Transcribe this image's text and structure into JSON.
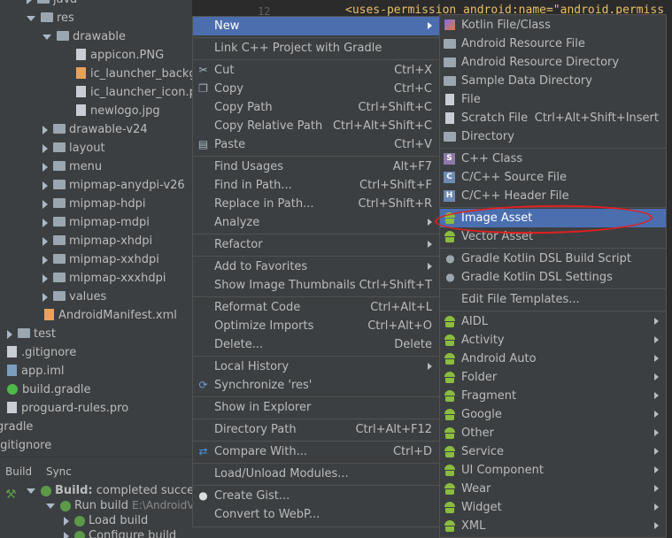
{
  "tree": {
    "items": [
      {
        "label": "java",
        "indent": 1,
        "kind": "folder",
        "arrow": "right"
      },
      {
        "label": "res",
        "indent": 1,
        "kind": "folder",
        "arrow": "down"
      },
      {
        "label": "drawable",
        "indent": 2,
        "kind": "folder",
        "arrow": "down"
      },
      {
        "label": "appicon.PNG",
        "indent": 3,
        "kind": "file"
      },
      {
        "label": "ic_launcher_backgr",
        "indent": 3,
        "kind": "xml"
      },
      {
        "label": "ic_launcher_icon.pn",
        "indent": 3,
        "kind": "file"
      },
      {
        "label": "newlogo.jpg",
        "indent": 3,
        "kind": "file"
      },
      {
        "label": "drawable-v24",
        "indent": 2,
        "kind": "folder",
        "arrow": "right"
      },
      {
        "label": "layout",
        "indent": 2,
        "kind": "folder",
        "arrow": "right"
      },
      {
        "label": "menu",
        "indent": 2,
        "kind": "folder",
        "arrow": "right"
      },
      {
        "label": "mipmap-anydpi-v26",
        "indent": 2,
        "kind": "folder",
        "arrow": "right"
      },
      {
        "label": "mipmap-hdpi",
        "indent": 2,
        "kind": "folder",
        "arrow": "right"
      },
      {
        "label": "mipmap-mdpi",
        "indent": 2,
        "kind": "folder",
        "arrow": "right"
      },
      {
        "label": "mipmap-xhdpi",
        "indent": 2,
        "kind": "folder",
        "arrow": "right"
      },
      {
        "label": "mipmap-xxhdpi",
        "indent": 2,
        "kind": "folder",
        "arrow": "right"
      },
      {
        "label": "mipmap-xxxhdpi",
        "indent": 2,
        "kind": "folder",
        "arrow": "right"
      },
      {
        "label": "values",
        "indent": 2,
        "kind": "folder",
        "arrow": "right"
      },
      {
        "label": "AndroidManifest.xml",
        "indent": 2,
        "kind": "xml"
      },
      {
        "label": "test",
        "indent": 0,
        "kind": "folder",
        "arrow": "right"
      },
      {
        "label": ".gitignore",
        "indent": 0,
        "kind": "file"
      },
      {
        "label": "app.iml",
        "indent": 0,
        "kind": "iml"
      },
      {
        "label": "build.gradle",
        "indent": 0,
        "kind": "gradle"
      },
      {
        "label": "proguard-rules.pro",
        "indent": 0,
        "kind": "file"
      },
      {
        "label": "gradle",
        "indent": -1,
        "kind": "none"
      },
      {
        "label": ".gitignore",
        "indent": -1,
        "kind": "none"
      }
    ]
  },
  "editor": {
    "line_number": "12",
    "code": "<uses-permission android:name=\"android.permiss"
  },
  "build": {
    "tabs": [
      "Build",
      "Sync"
    ],
    "status_bold": "Build:",
    "status_text": "completed success",
    "run_build": "Run build",
    "run_path": "E:\\AndroidV",
    "load_build": "Load build",
    "configure_build": "Configure build"
  },
  "menu1": {
    "items": [
      {
        "label": "New",
        "shortcut": "",
        "arrow": true,
        "icon": "",
        "selected": true
      },
      {
        "sep": true
      },
      {
        "label": "Link C++ Project with Gradle",
        "shortcut": "",
        "arrow": false,
        "icon": ""
      },
      {
        "sep": true
      },
      {
        "label": "Cut",
        "shortcut": "Ctrl+X",
        "arrow": false,
        "icon": "scissors-icon"
      },
      {
        "label": "Copy",
        "shortcut": "Ctrl+C",
        "arrow": false,
        "icon": "copy-icon"
      },
      {
        "label": "Copy Path",
        "shortcut": "Ctrl+Shift+C",
        "arrow": false,
        "icon": ""
      },
      {
        "label": "Copy Relative Path",
        "shortcut": "Ctrl+Alt+Shift+C",
        "arrow": false,
        "icon": ""
      },
      {
        "label": "Paste",
        "shortcut": "Ctrl+V",
        "arrow": false,
        "icon": "paste-icon"
      },
      {
        "sep": true
      },
      {
        "label": "Find Usages",
        "shortcut": "Alt+F7",
        "arrow": false,
        "icon": ""
      },
      {
        "label": "Find in Path...",
        "shortcut": "Ctrl+Shift+F",
        "arrow": false,
        "icon": ""
      },
      {
        "label": "Replace in Path...",
        "shortcut": "Ctrl+Shift+R",
        "arrow": false,
        "icon": ""
      },
      {
        "label": "Analyze",
        "shortcut": "",
        "arrow": true,
        "icon": ""
      },
      {
        "sep": true
      },
      {
        "label": "Refactor",
        "shortcut": "",
        "arrow": true,
        "icon": ""
      },
      {
        "sep": true
      },
      {
        "label": "Add to Favorites",
        "shortcut": "",
        "arrow": true,
        "icon": ""
      },
      {
        "label": "Show Image Thumbnails",
        "shortcut": "Ctrl+Shift+T",
        "arrow": false,
        "icon": ""
      },
      {
        "sep": true
      },
      {
        "label": "Reformat Code",
        "shortcut": "Ctrl+Alt+L",
        "arrow": false,
        "icon": ""
      },
      {
        "label": "Optimize Imports",
        "shortcut": "Ctrl+Alt+O",
        "arrow": false,
        "icon": ""
      },
      {
        "label": "Delete...",
        "shortcut": "Delete",
        "arrow": false,
        "icon": ""
      },
      {
        "sep": true
      },
      {
        "label": "Local History",
        "shortcut": "",
        "arrow": true,
        "icon": ""
      },
      {
        "label": "Synchronize 'res'",
        "shortcut": "",
        "arrow": false,
        "icon": "sync-icon"
      },
      {
        "sep": true
      },
      {
        "label": "Show in Explorer",
        "shortcut": "",
        "arrow": false,
        "icon": ""
      },
      {
        "sep": true
      },
      {
        "label": "Directory Path",
        "shortcut": "Ctrl+Alt+F12",
        "arrow": false,
        "icon": ""
      },
      {
        "sep": true
      },
      {
        "label": "Compare With...",
        "shortcut": "Ctrl+D",
        "arrow": false,
        "icon": "compare-icon"
      },
      {
        "sep": true
      },
      {
        "label": "Load/Unload Modules...",
        "shortcut": "",
        "arrow": false,
        "icon": ""
      },
      {
        "sep": true
      },
      {
        "label": "Create Gist...",
        "shortcut": "",
        "arrow": false,
        "icon": "github-icon"
      },
      {
        "label": "Convert to WebP...",
        "shortcut": "",
        "arrow": false,
        "icon": ""
      }
    ]
  },
  "menu2": {
    "items": [
      {
        "label": "Kotlin File/Class",
        "shortcut": "",
        "arrow": false,
        "icon": "kotlin-icon"
      },
      {
        "label": "Android Resource File",
        "shortcut": "",
        "arrow": false,
        "icon": "folder-icon"
      },
      {
        "label": "Android Resource Directory",
        "shortcut": "",
        "arrow": false,
        "icon": "folder-icon"
      },
      {
        "label": "Sample Data Directory",
        "shortcut": "",
        "arrow": false,
        "icon": "folder-icon"
      },
      {
        "label": "File",
        "shortcut": "",
        "arrow": false,
        "icon": "file-icon"
      },
      {
        "label": "Scratch File",
        "shortcut": "Ctrl+Alt+Shift+Insert",
        "arrow": false,
        "icon": "scratch-icon"
      },
      {
        "label": "Directory",
        "shortcut": "",
        "arrow": false,
        "icon": "folder-icon"
      },
      {
        "sep": true
      },
      {
        "label": "C++ Class",
        "shortcut": "",
        "arrow": false,
        "icon": "cpp-class-icon"
      },
      {
        "label": "C/C++ Source File",
        "shortcut": "",
        "arrow": false,
        "icon": "cpp-source-icon"
      },
      {
        "label": "C/C++ Header File",
        "shortcut": "",
        "arrow": false,
        "icon": "cpp-header-icon"
      },
      {
        "sep": true
      },
      {
        "label": "Image Asset",
        "shortcut": "",
        "arrow": false,
        "icon": "android-icon",
        "selected": true
      },
      {
        "label": "Vector Asset",
        "shortcut": "",
        "arrow": false,
        "icon": "android-icon"
      },
      {
        "sep": true
      },
      {
        "label": "Gradle Kotlin DSL Build Script",
        "shortcut": "",
        "arrow": false,
        "icon": "gradle-icon"
      },
      {
        "label": "Gradle Kotlin DSL Settings",
        "shortcut": "",
        "arrow": false,
        "icon": "gradle-icon"
      },
      {
        "sep": true
      },
      {
        "label": "Edit File Templates...",
        "shortcut": "",
        "arrow": false,
        "icon": ""
      },
      {
        "sep": true
      },
      {
        "label": "AIDL",
        "shortcut": "",
        "arrow": true,
        "icon": "android-icon"
      },
      {
        "label": "Activity",
        "shortcut": "",
        "arrow": true,
        "icon": "android-icon"
      },
      {
        "label": "Android Auto",
        "shortcut": "",
        "arrow": true,
        "icon": "android-icon"
      },
      {
        "label": "Folder",
        "shortcut": "",
        "arrow": true,
        "icon": "android-icon"
      },
      {
        "label": "Fragment",
        "shortcut": "",
        "arrow": true,
        "icon": "android-icon"
      },
      {
        "label": "Google",
        "shortcut": "",
        "arrow": true,
        "icon": "android-icon"
      },
      {
        "label": "Other",
        "shortcut": "",
        "arrow": true,
        "icon": "android-icon"
      },
      {
        "label": "Service",
        "shortcut": "",
        "arrow": true,
        "icon": "android-icon"
      },
      {
        "label": "UI Component",
        "shortcut": "",
        "arrow": true,
        "icon": "android-icon"
      },
      {
        "label": "Wear",
        "shortcut": "",
        "arrow": true,
        "icon": "android-icon"
      },
      {
        "label": "Widget",
        "shortcut": "",
        "arrow": true,
        "icon": "android-icon"
      },
      {
        "label": "XML",
        "shortcut": "",
        "arrow": true,
        "icon": "android-icon"
      }
    ]
  },
  "colors": {
    "selection": "#4b6eaf",
    "annotation": "#e02020"
  }
}
